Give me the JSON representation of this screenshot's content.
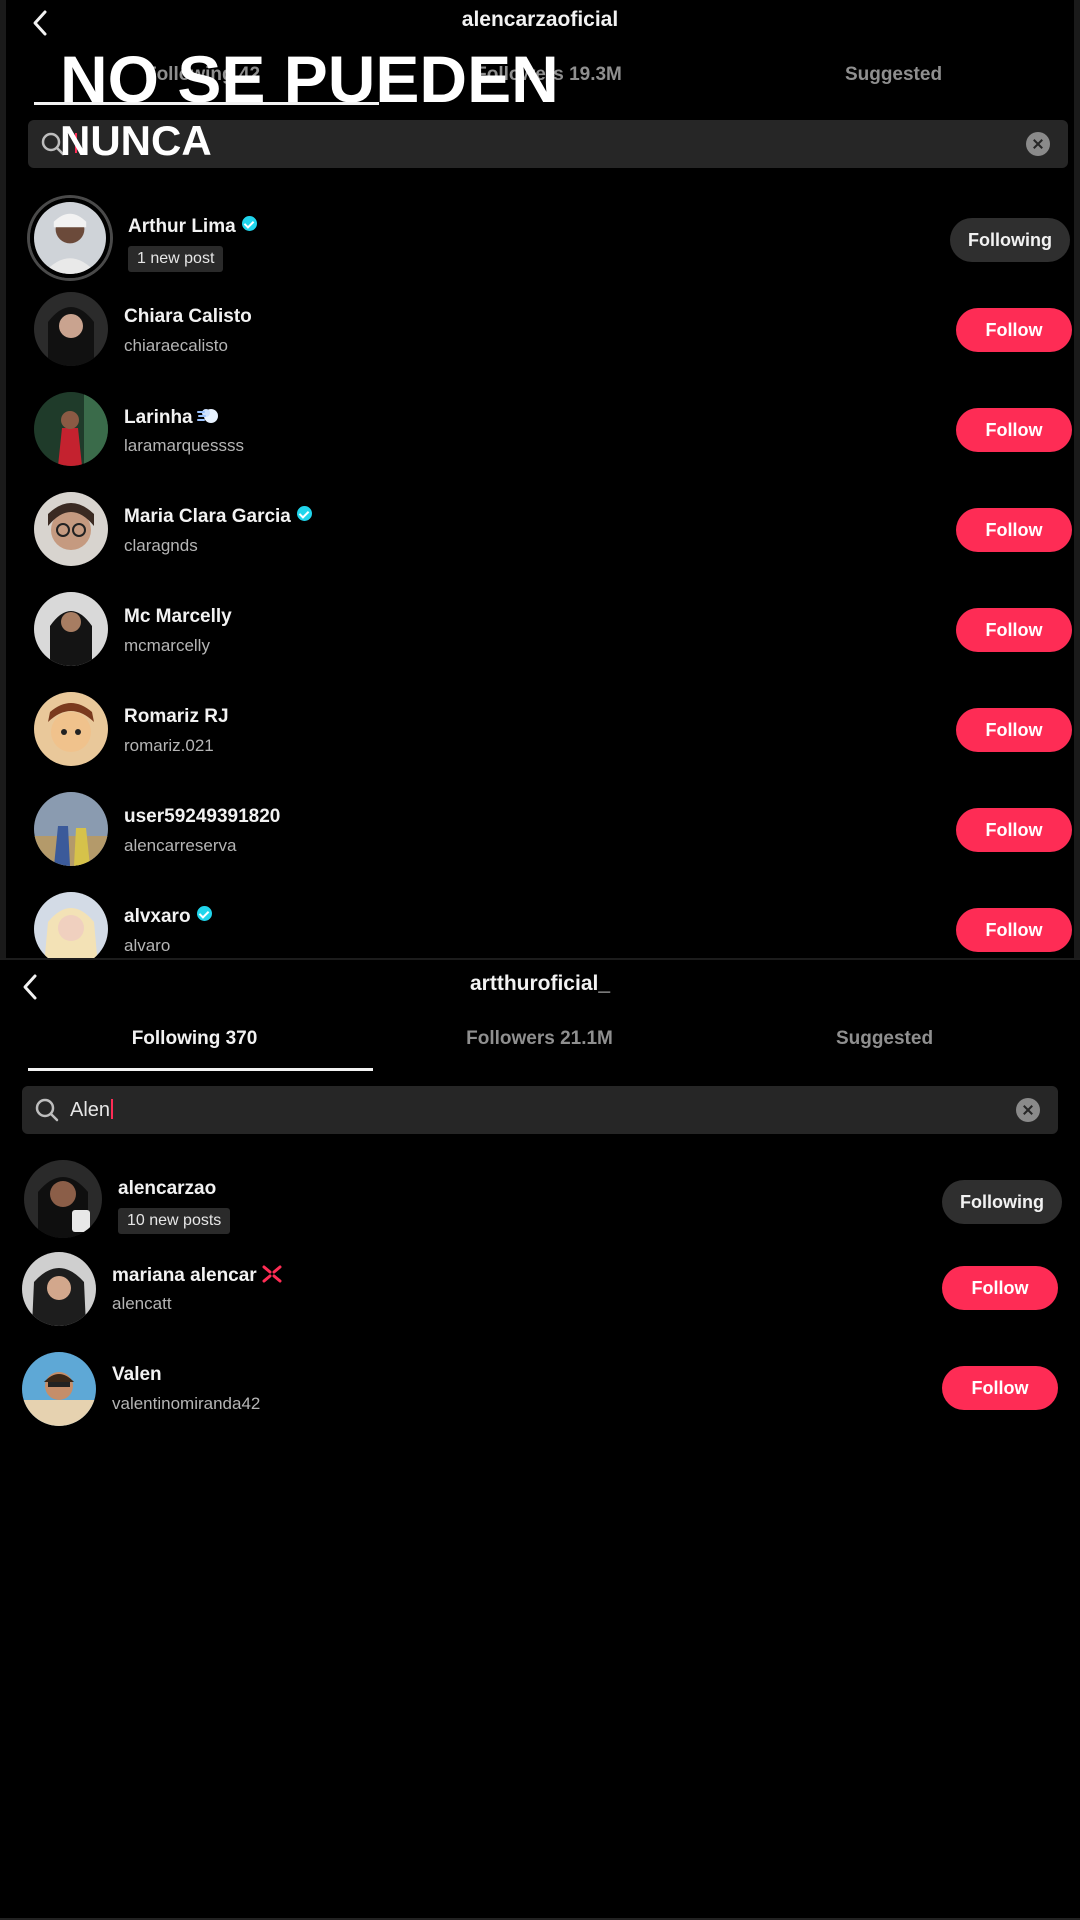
{
  "overlay": {
    "line1": "NO SE PUEDEN",
    "line2": "NUNCA"
  },
  "top_screen": {
    "title": "alencarzaoficial",
    "tabs": {
      "following": "Following 42",
      "followers": "Followers 19.3M",
      "suggested": "Suggested"
    },
    "search_value": "",
    "users": [
      {
        "name": "Arthur Lima",
        "verified": true,
        "sub": "1 new post",
        "sub_is_badge": true,
        "button": "Following"
      },
      {
        "name": "Chiara Calisto",
        "verified": false,
        "sub": "chiaraecalisto",
        "button": "Follow"
      },
      {
        "name": "Larinha",
        "verified": false,
        "emoji": "dash-icon",
        "sub": "laramarquessss",
        "button": "Follow"
      },
      {
        "name": "Maria Clara Garcia",
        "verified": true,
        "sub": "claragnds",
        "button": "Follow"
      },
      {
        "name": "Mc Marcelly",
        "verified": false,
        "sub": "mcmarcelly",
        "button": "Follow"
      },
      {
        "name": "Romariz RJ",
        "verified": false,
        "sub": "romariz.021",
        "button": "Follow"
      },
      {
        "name": "user59249391820",
        "verified": false,
        "sub": "alencarreserva",
        "button": "Follow"
      },
      {
        "name": "alvxaro",
        "verified": true,
        "sub": "alvaro",
        "button": "Follow"
      }
    ]
  },
  "bottom_screen": {
    "title": "artthuroficial_",
    "tabs": {
      "following": "Following 370",
      "followers": "Followers 21.1M",
      "suggested": "Suggested"
    },
    "search_value": "Alen",
    "users": [
      {
        "name": "alencarzao",
        "verified": false,
        "sub": "10 new posts",
        "sub_is_badge": true,
        "button": "Following"
      },
      {
        "name": "mariana alencar",
        "verified": false,
        "emoji": "anger-icon",
        "sub": "alencatt",
        "button": "Follow"
      },
      {
        "name": "Valen",
        "verified": false,
        "sub": "valentinomiranda42",
        "button": "Follow"
      }
    ]
  },
  "colors": {
    "accent": "#fe2c55",
    "verified": "#20d5ec",
    "background": "#000000"
  }
}
